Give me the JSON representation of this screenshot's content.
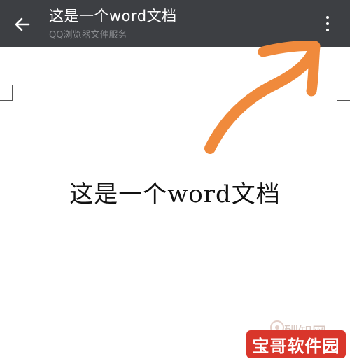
{
  "toolbar": {
    "title": "这是一个word文档",
    "subtitle": "QQ浏览器文件服务",
    "back_icon": "arrow-left-icon",
    "menu_icon": "more-vertical-icon",
    "background": "#3d3f43"
  },
  "document": {
    "body_text": "这是一个word文档"
  },
  "annotation": {
    "arrow_color": "#f08a3c"
  },
  "watermarks": {
    "site_text": "酬知网",
    "brand_text": "宝哥软件园",
    "brand_color": "#d9362b"
  }
}
